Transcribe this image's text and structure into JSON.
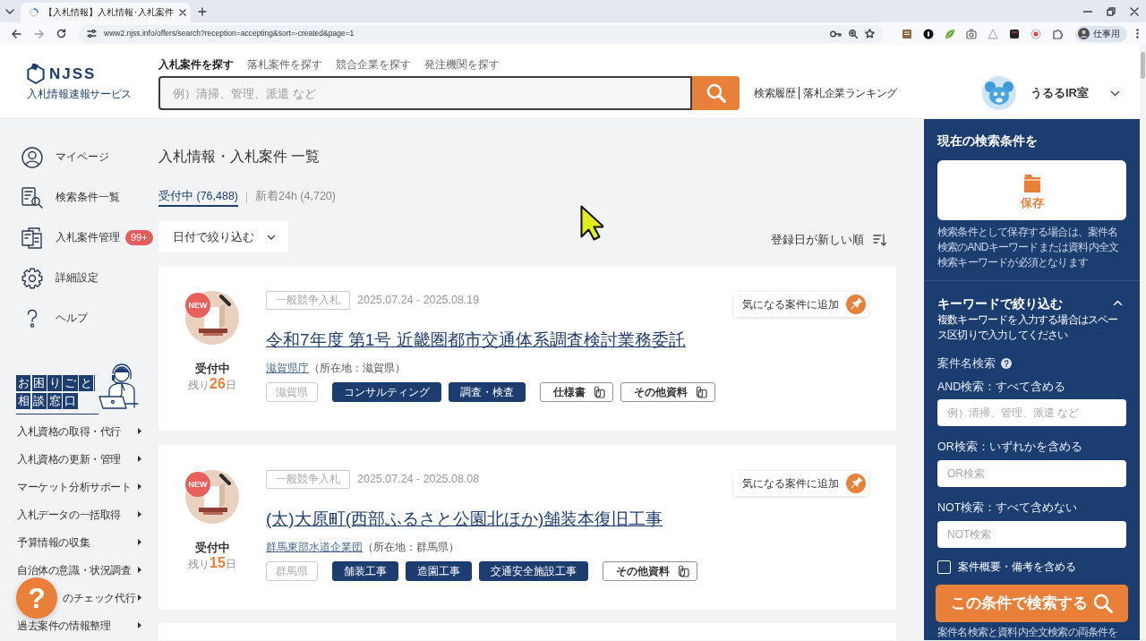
{
  "browser": {
    "tab_title": "【入札情報】入札情報･入札案件",
    "url": "www2.njss.info/offers/search?reception=accepting&sort=-created&page=1",
    "profile": "仕事用"
  },
  "header": {
    "logo": {
      "wordmark": "NJSS",
      "tagline": "入札情報速報サービス"
    },
    "nav": [
      {
        "label": "入札案件を探す",
        "selected": true
      },
      {
        "label": "落札案件を探す",
        "selected": false
      },
      {
        "label": "競合企業を探す",
        "selected": false
      },
      {
        "label": "発注機関を探す",
        "selected": false
      }
    ],
    "search": {
      "placeholder": "例）清掃、管理、派遣 など"
    },
    "links": [
      "検索履歴",
      "落札企業ランキング"
    ],
    "user": {
      "name": "うるるIR室"
    }
  },
  "sidebar": {
    "items": [
      {
        "label": "マイページ"
      },
      {
        "label": "検索条件一覧"
      },
      {
        "label": "入札案件管理",
        "badge": "99+"
      },
      {
        "label": "詳細設定"
      },
      {
        "label": "ヘルプ"
      }
    ],
    "banner": {
      "lines": [
        "お困りごと",
        "相談窓口"
      ]
    },
    "services": [
      {
        "label": "入札資格の取得・代行",
        "partly_hidden": false
      },
      {
        "label": "入札資格の更新・管理",
        "partly_hidden": false
      },
      {
        "label": "マーケット分析サポート",
        "partly_hidden": false
      },
      {
        "label": "入札データの一括取得",
        "partly_hidden": false
      },
      {
        "label": "予算情報の収集",
        "partly_hidden": false
      },
      {
        "label": "自治体の意識・状況調査",
        "partly_hidden": false
      },
      {
        "label": "のチェック代行",
        "partly_hidden": true
      },
      {
        "label": "過去案件の情報整理",
        "partly_hidden": false
      }
    ],
    "help_button": {
      "label": "?"
    }
  },
  "main": {
    "title": "入札情報・入札案件 一覧",
    "tabs": [
      {
        "label": "受付中 (76,488)",
        "selected": true
      },
      {
        "label": "新着24h (4,720)",
        "selected": false
      }
    ],
    "date_filter": "日付で絞り込む",
    "sort": "登録日が新しい順",
    "listings": [
      {
        "badge": "NEW",
        "status": "受付中",
        "remaining": "残り**26**日",
        "method": "一般競争入札",
        "period": "2025.07.24 - 2025.08.19",
        "title": "令和7年度 第1号 近畿圏都市交通体系調査検討業務委託",
        "agency": "滋賀県庁",
        "location": "（所在地：滋賀県）",
        "tags": [
          {
            "label": "滋賀県",
            "kind": "region"
          },
          {
            "label": "コンサルティング",
            "kind": "category"
          },
          {
            "label": "調査・検査",
            "kind": "category"
          },
          {
            "label": "仕様書",
            "kind": "document"
          },
          {
            "label": "その他資料",
            "kind": "document"
          }
        ],
        "watch_label": "気になる案件に追加"
      },
      {
        "badge": "NEW",
        "status": "受付中",
        "remaining": "残り**15**日",
        "method": "一般競争入札",
        "period": "2025.07.24 - 2025.08.08",
        "title": "(太)大原町(西部ふるさと公園北ほか)舗装本復旧工事",
        "agency": "群馬東部水道企業団",
        "location": "（所在地：群馬県）",
        "tags": [
          {
            "label": "群馬県",
            "kind": "region"
          },
          {
            "label": "舗装工事",
            "kind": "category"
          },
          {
            "label": "造園工事",
            "kind": "category"
          },
          {
            "label": "交通安全施設工事",
            "kind": "category"
          },
          {
            "label": "その他資料",
            "kind": "document"
          }
        ],
        "watch_label": "気になる案件に追加"
      }
    ]
  },
  "panel": {
    "save": {
      "heading": "現在の検索条件を",
      "button": "保存",
      "note": "検索条件として保存する場合は、案件名検索のANDキーワードまたは資料内全文検索キーワードが必須となります"
    },
    "keyword": {
      "heading": "キーワードで絞り込む",
      "expanded": true,
      "hint": "複数キーワードを入力する場合はスペース区切りで入力してください",
      "section": "案件名検索",
      "fields": [
        {
          "label": "AND検索：すべて含める",
          "placeholder": "例）清掃、管理、派遣 など"
        },
        {
          "label": "OR検索：いずれかを含める",
          "placeholder": "OR検索"
        },
        {
          "label": "NOT検索：すべて含めない",
          "placeholder": "NOT検索"
        }
      ],
      "include_summary": {
        "label": "案件概要・備考を含める",
        "checked": false
      },
      "search_button": "この条件で検索する",
      "footnote": "案件名検索と資料内全文検索の両条件を"
    }
  }
}
